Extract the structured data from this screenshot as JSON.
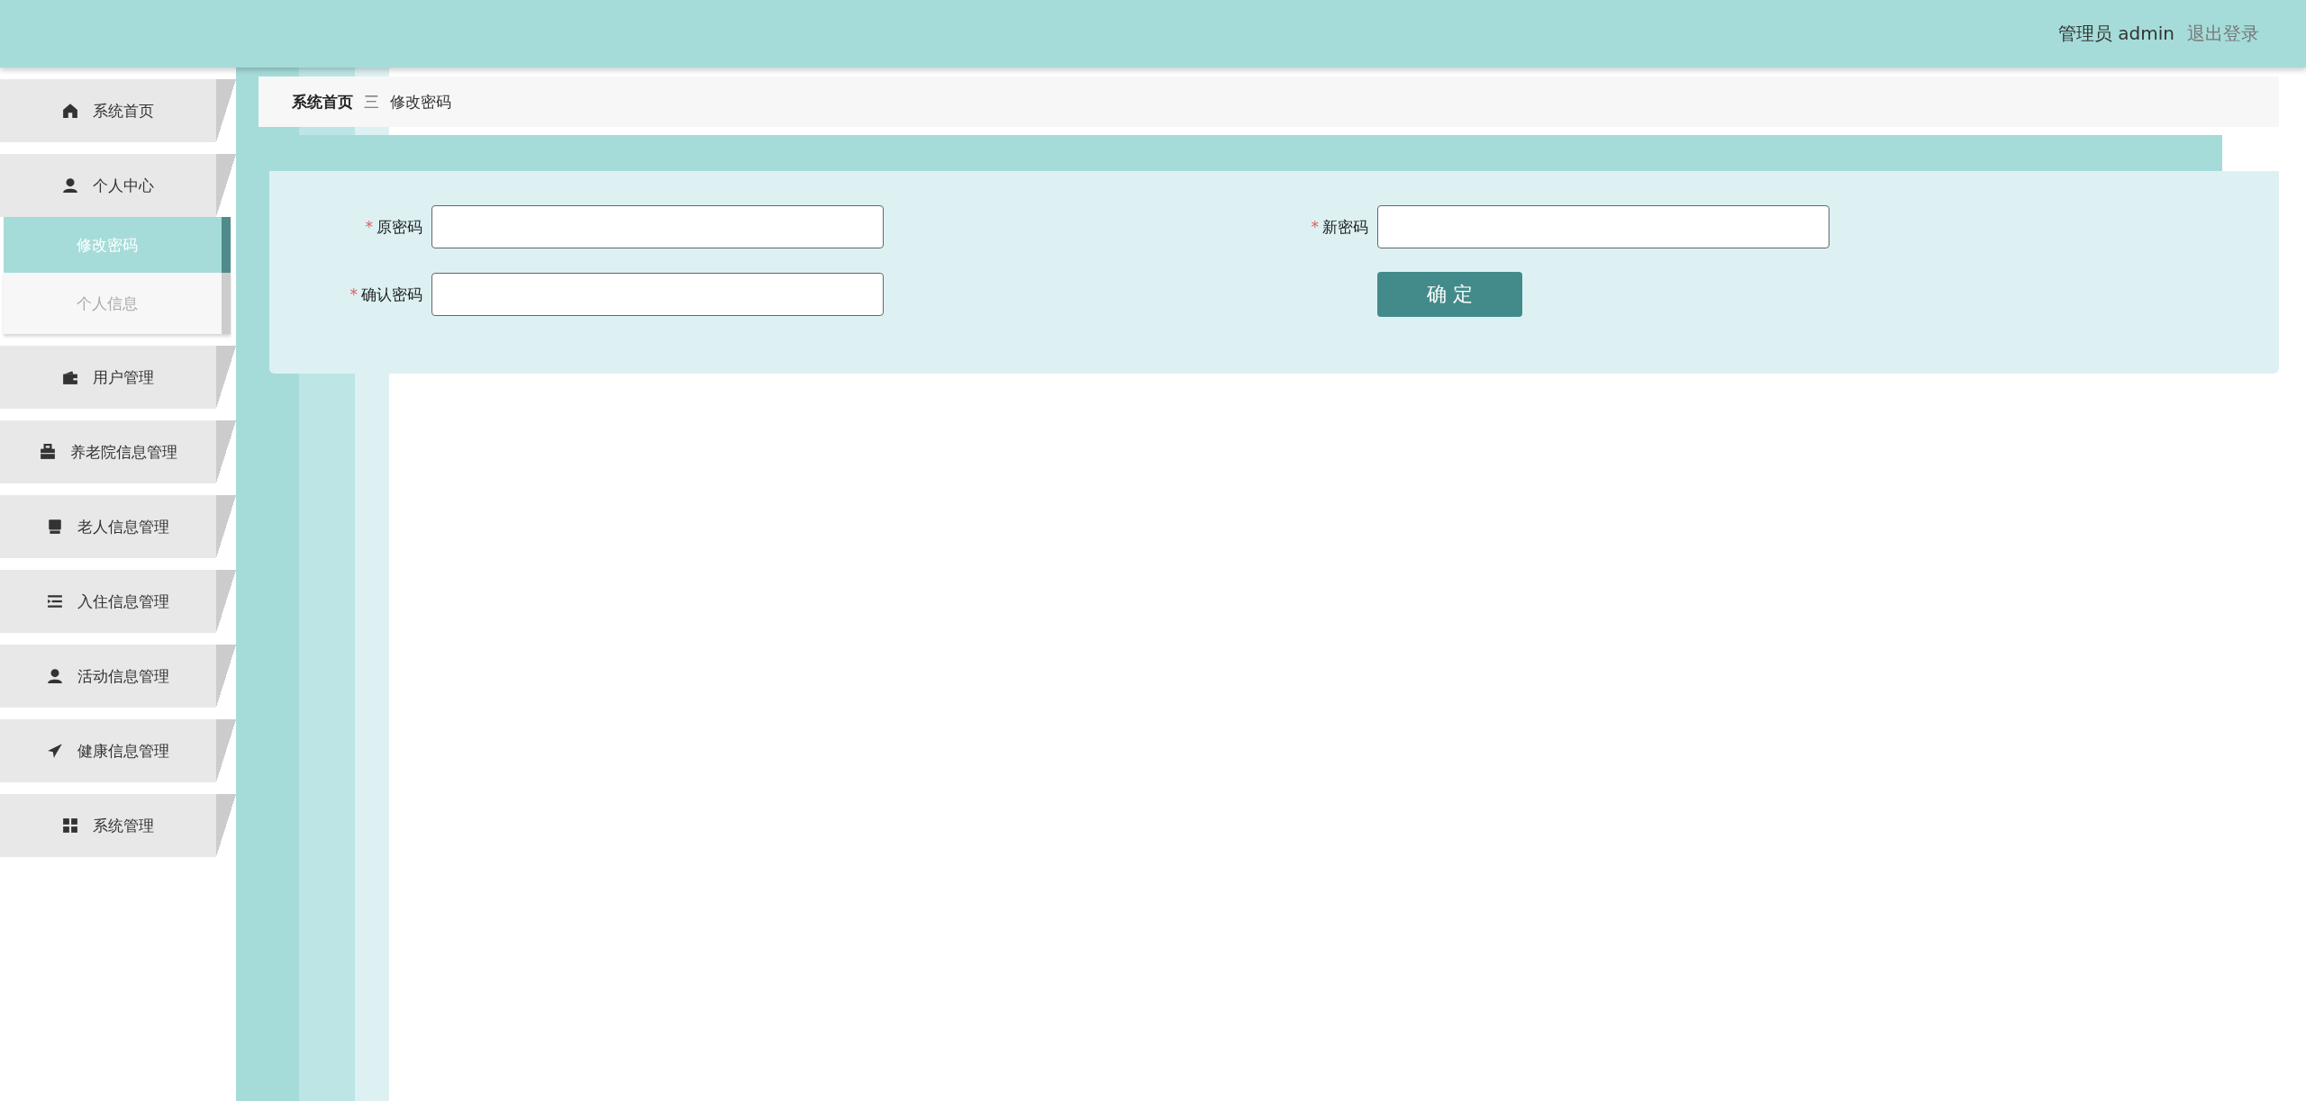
{
  "header": {
    "user_label": "管理员 admin",
    "logout": "退出登录"
  },
  "sidebar": {
    "items": [
      {
        "label": "系统首页"
      },
      {
        "label": "个人中心",
        "children": [
          {
            "label": "修改密码",
            "selected": true
          },
          {
            "label": "个人信息",
            "selected": false
          }
        ]
      },
      {
        "label": "用户管理"
      },
      {
        "label": "养老院信息管理"
      },
      {
        "label": "老人信息管理"
      },
      {
        "label": "入住信息管理"
      },
      {
        "label": "活动信息管理"
      },
      {
        "label": "健康信息管理"
      },
      {
        "label": "系统管理"
      }
    ]
  },
  "breadcrumb": {
    "items": [
      "系统首页",
      "修改密码"
    ],
    "separator": "三"
  },
  "form": {
    "fields": [
      {
        "label": "原密码",
        "required_mark": "*"
      },
      {
        "label": "新密码",
        "required_mark": "*"
      },
      {
        "label": "确认密码",
        "required_mark": "*"
      }
    ],
    "submit": "确 定"
  }
}
